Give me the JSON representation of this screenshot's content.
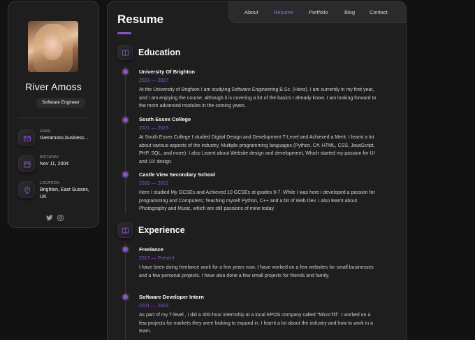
{
  "sidebar": {
    "name": "River Amoss",
    "title": "Software Engineer",
    "contacts": [
      {
        "label": "Email",
        "value": "riveramoss.business..."
      },
      {
        "label": "Birthday",
        "value": "Nov 11, 2004"
      },
      {
        "label": "Location",
        "value": "Brighton, East Sussex, UK"
      }
    ]
  },
  "nav": [
    "About",
    "Resume",
    "Portfolio",
    "Blog",
    "Contact"
  ],
  "nav_active": "Resume",
  "page_title": "Resume",
  "education": {
    "title": "Education",
    "items": [
      {
        "title": "University Of Brighton",
        "date": "2023 — 2027",
        "text": "At the University of Brighton I am studying Software Engineering B.Sc. (Hons). I am currently in my first year, and I am enjoying the course, although it is covering a lot of the basics I already know. I am looking forward to the more advanced modules in the coming years."
      },
      {
        "title": "South Essex College",
        "date": "2021 — 2023",
        "text": "At South Essex College I studied Digital Design and Development T-Level and Achieved a Merit. I learnt a lot about various aspects of the industry, Multiple programming languages (Python, C#, HTML, CSS, JavaScript, PHP, SQL, and more). I also Learnt about Website design and development, Which started my passion for UI and UX design."
      },
      {
        "title": "Castle View Secondary School",
        "date": "2016 — 2021",
        "text": "Here I studied My GCSEs and Achieved 10 GCSEs at grades 9-7. While I was here i developed a passion for programming and Computers; Teaching myself Python, C++ and a bit of Web Dev. I also learnt about Photography and Music, which are still passions of mine today."
      }
    ]
  },
  "experience": {
    "title": "Experience",
    "items": [
      {
        "title": "Freelance",
        "date": "2017 — Present",
        "text": "I have been doing freelance work for a few years now, I have worked on a few websites for small businesses and a few personal projects. I have also done a few small projects for friends and family."
      },
      {
        "title": "Software Developer Intern",
        "date": "2021 — 2023",
        "text": "As part of my T-level , I did a 400-hour internship at a local EPOS company called \"MicroTill\". I worked on a few projects for markets they were looking to expand in. I learnt a lot about the industry and how to work in a team."
      }
    ]
  },
  "colors": {
    "accent": "#8a55c9",
    "background": "#121212",
    "card": "#1e1e1f"
  }
}
